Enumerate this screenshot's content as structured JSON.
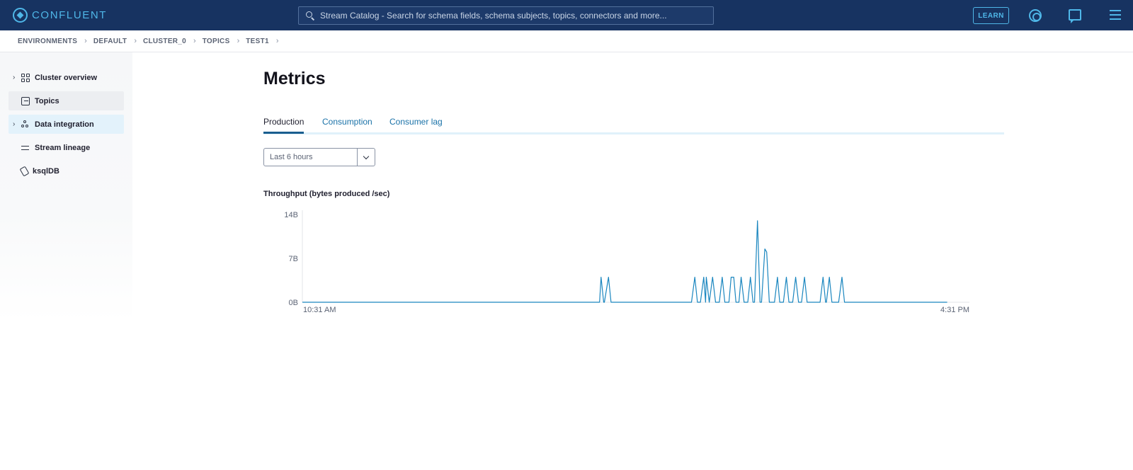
{
  "header": {
    "logo_text": "CONFLUENT",
    "search_placeholder": "Stream Catalog - Search for schema fields, schema subjects, topics, connectors and more...",
    "learn_label": "LEARN"
  },
  "breadcrumb": [
    "ENVIRONMENTS",
    "DEFAULT",
    "CLUSTER_0",
    "TOPICS",
    "TEST1"
  ],
  "sidebar": {
    "items": [
      {
        "label": "Cluster overview",
        "icon": "grid-icon",
        "expandable": true
      },
      {
        "label": "Topics",
        "icon": "topic-icon",
        "expandable": false
      },
      {
        "label": "Data integration",
        "icon": "data-integration-icon",
        "expandable": true
      },
      {
        "label": "Stream lineage",
        "icon": "lineage-icon",
        "expandable": false
      },
      {
        "label": "ksqlDB",
        "icon": "ksqldb-icon",
        "expandable": false
      }
    ]
  },
  "main": {
    "title": "Metrics",
    "tabs": [
      "Production",
      "Consumption",
      "Consumer lag"
    ],
    "time_range": "Last 6 hours",
    "chart_title": "Throughput (bytes produced /sec)"
  },
  "colors": {
    "topbar": "#173361",
    "accent": "#4fb7e8",
    "line": "#1a86bf",
    "tab_link": "#1a72a8"
  },
  "chart_data": {
    "type": "line",
    "title": "Throughput (bytes produced /sec)",
    "yticks": [
      "14B",
      "7B",
      "0B"
    ],
    "xticks": [
      "10:31 AM",
      "4:31 PM"
    ],
    "ylim": [
      0,
      14
    ],
    "x_range_minutes": [
      0,
      360
    ],
    "series": [
      {
        "points": [
          [
            0,
            0
          ],
          [
            160.4,
            0
          ],
          [
            161.2,
            4
          ],
          [
            162.6,
            0
          ],
          [
            163.0,
            0
          ],
          [
            165.2,
            4
          ],
          [
            166.6,
            0
          ],
          [
            210.0,
            0
          ],
          [
            211.8,
            4
          ],
          [
            213.2,
            0
          ],
          [
            214.8,
            0
          ],
          [
            216.6,
            4
          ],
          [
            217.6,
            0
          ],
          [
            218.0,
            4
          ],
          [
            219.6,
            0
          ],
          [
            221.4,
            4
          ],
          [
            223.0,
            0
          ],
          [
            225.0,
            0
          ],
          [
            226.6,
            4
          ],
          [
            228.0,
            0
          ],
          [
            230.2,
            0
          ],
          [
            231.4,
            4
          ],
          [
            232.8,
            4
          ],
          [
            234.0,
            0
          ],
          [
            235.6,
            0
          ],
          [
            236.8,
            4
          ],
          [
            238.4,
            0
          ],
          [
            240.4,
            0
          ],
          [
            241.8,
            4
          ],
          [
            243.2,
            0
          ],
          [
            244.0,
            0
          ],
          [
            245.6,
            13
          ],
          [
            247.0,
            0
          ],
          [
            247.8,
            0
          ],
          [
            249.6,
            8.5
          ],
          [
            250.6,
            8
          ],
          [
            252.0,
            0
          ],
          [
            254.8,
            0
          ],
          [
            256.4,
            4
          ],
          [
            257.6,
            0
          ],
          [
            259.6,
            0
          ],
          [
            261.2,
            4
          ],
          [
            262.6,
            0
          ],
          [
            264.6,
            0
          ],
          [
            266.2,
            4
          ],
          [
            267.8,
            0
          ],
          [
            269.4,
            0
          ],
          [
            271.0,
            4
          ],
          [
            272.4,
            0
          ],
          [
            279.4,
            0
          ],
          [
            281.0,
            4
          ],
          [
            282.4,
            0
          ],
          [
            282.8,
            0
          ],
          [
            284.4,
            4
          ],
          [
            285.8,
            0
          ],
          [
            289.4,
            0
          ],
          [
            291.2,
            4
          ],
          [
            292.6,
            0
          ],
          [
            348.0,
            0
          ]
        ]
      }
    ]
  }
}
